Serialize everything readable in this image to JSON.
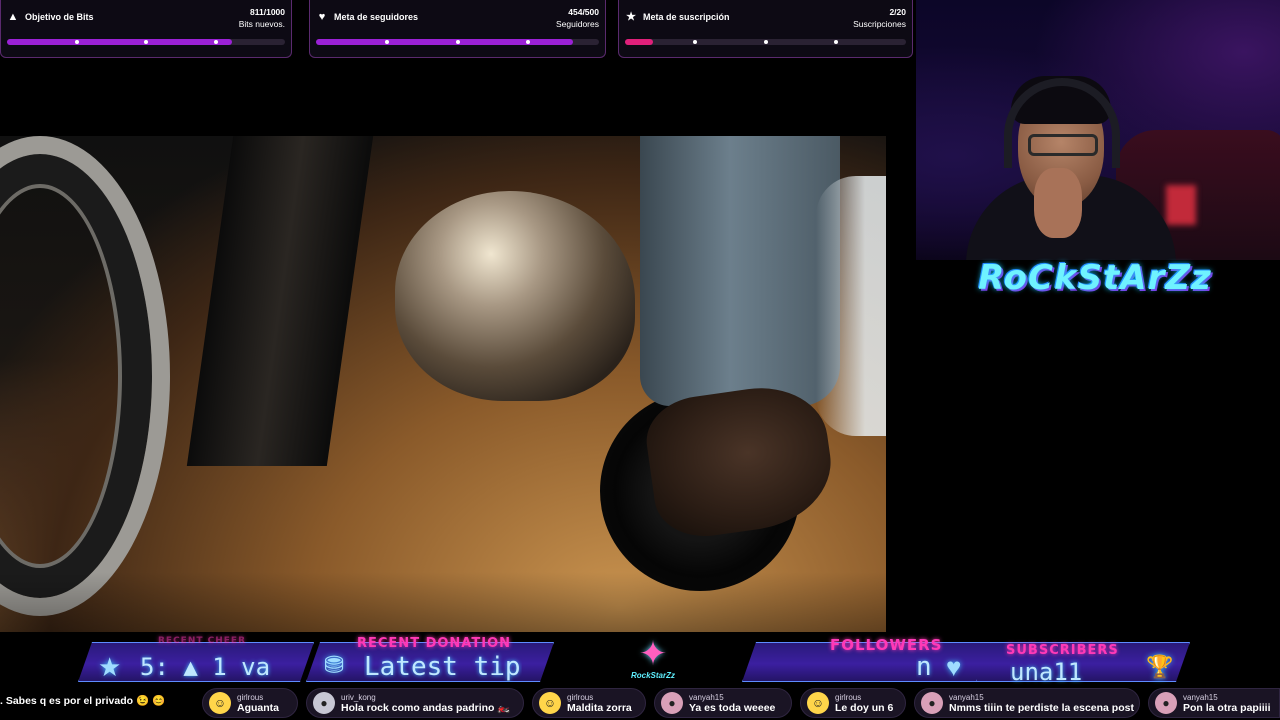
{
  "goals": [
    {
      "icon": "bits-icon",
      "glyph": "▲",
      "title": "Objetivo de Bits",
      "count": "811/1000",
      "subtitle": "Bits nuevos.",
      "progress": 0.811,
      "fill_color": "#9b21d6"
    },
    {
      "icon": "followers-icon",
      "glyph": "♥",
      "title": "Meta de seguidores",
      "count": "454/500",
      "subtitle": "Seguidores",
      "progress": 0.908,
      "fill_color": "#9b21d6"
    },
    {
      "icon": "subscription-icon",
      "glyph": "★",
      "title": "Meta de suscripción",
      "count": "2/20",
      "subtitle": "Suscripciones",
      "progress": 0.1,
      "fill_color": "#e0207a"
    }
  ],
  "logo": {
    "text": "RoCkStArZz"
  },
  "banner": {
    "recent_cheer_title": "RECENT CHEER",
    "recent_cheer_value": "5: ▲ 1   va",
    "recent_donation_title": "RECENT DONATION",
    "recent_donation_value": "Latest tip",
    "mascot_label": "RockStarZz",
    "followers_title": "FOLLOWERS",
    "followers_value": "n",
    "subscribers_title": "SUBSCRIBERS",
    "subscribers_value": "una11"
  },
  "chat": {
    "leading_message": ". Sabes q es por el privado 😉 😊",
    "messages": [
      {
        "user": "girlrous",
        "text": "Aguanta",
        "avatar_color": "#ffd54a"
      },
      {
        "user": "uriv_kong",
        "text": "Hola rock como andas padrino 🏍️",
        "avatar_color": "#c7c7d4"
      },
      {
        "user": "girlrous",
        "text": "Maldita zorra",
        "avatar_color": "#ffd54a"
      },
      {
        "user": "vanyah15",
        "text": "Ya es toda weeee",
        "avatar_color": "#d9a0b8"
      },
      {
        "user": "girlrous",
        "text": "Le doy un 6",
        "avatar_color": "#ffd54a"
      },
      {
        "user": "vanyah15",
        "text": "Nmms tiiin te perdiste la escena post",
        "avatar_color": "#d9a0b8"
      },
      {
        "user": "vanyah15",
        "text": "Pon la otra papiiii",
        "avatar_color": "#d9a0b8"
      }
    ]
  },
  "colors": {
    "accent": "#ff39b7",
    "neon_blue": "#6ff2ff",
    "goal_border": "#5a2a6e"
  }
}
